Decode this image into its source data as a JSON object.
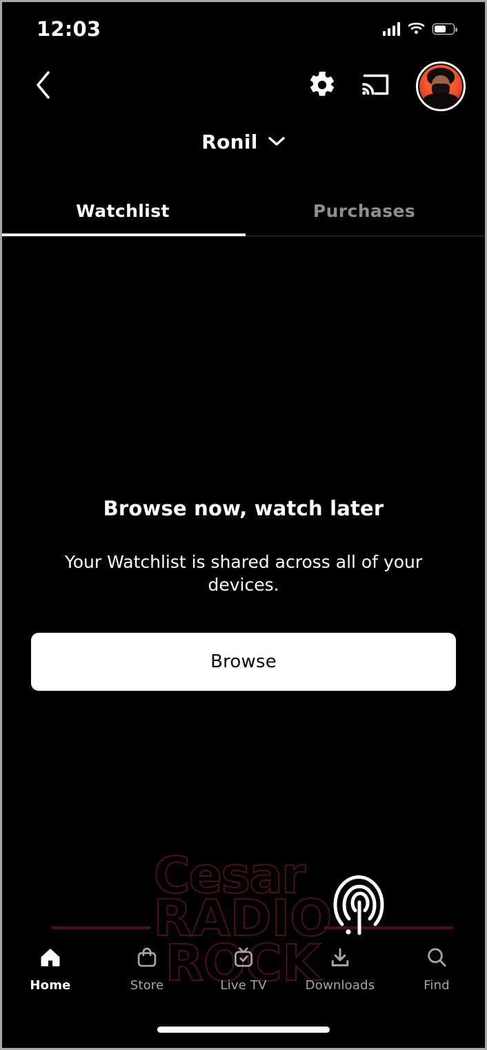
{
  "status_bar": {
    "time": "12:03",
    "signal_icon": "cellular-signal-icon",
    "wifi_icon": "wifi-icon",
    "battery_icon": "battery-icon",
    "battery_level_pct": 62
  },
  "nav_bar": {
    "back_icon": "chevron-left-icon",
    "settings_icon": "gear-icon",
    "cast_icon": "cast-icon",
    "avatar_icon": "profile-avatar"
  },
  "profile": {
    "name": "Ronil",
    "chevron_icon": "chevron-down-icon"
  },
  "tabs": [
    {
      "label": "Watchlist",
      "active": true
    },
    {
      "label": "Purchases",
      "active": false
    }
  ],
  "empty_state": {
    "title": "Browse now, watch later",
    "subtitle": "Your Watchlist is shared across all of your devices.",
    "button_label": "Browse"
  },
  "watermark": {
    "line1": "Cesar",
    "line2": "RADIO",
    "line3": "ROCK",
    "mark_icon": "broadcast-arcs-icon",
    "color": "#4a1118"
  },
  "bottom_nav": [
    {
      "label": "Home",
      "icon": "home-icon",
      "active": true
    },
    {
      "label": "Store",
      "icon": "shopping-bag-icon",
      "active": false
    },
    {
      "label": "Live TV",
      "icon": "live-tv-icon",
      "active": false
    },
    {
      "label": "Downloads",
      "icon": "download-icon",
      "active": false
    },
    {
      "label": "Find",
      "icon": "search-icon",
      "active": false
    }
  ],
  "colors": {
    "background": "#000000",
    "accent_white": "#ffffff",
    "inactive_gray": "#a6a6a6",
    "watermark_red": "#4a1118"
  }
}
